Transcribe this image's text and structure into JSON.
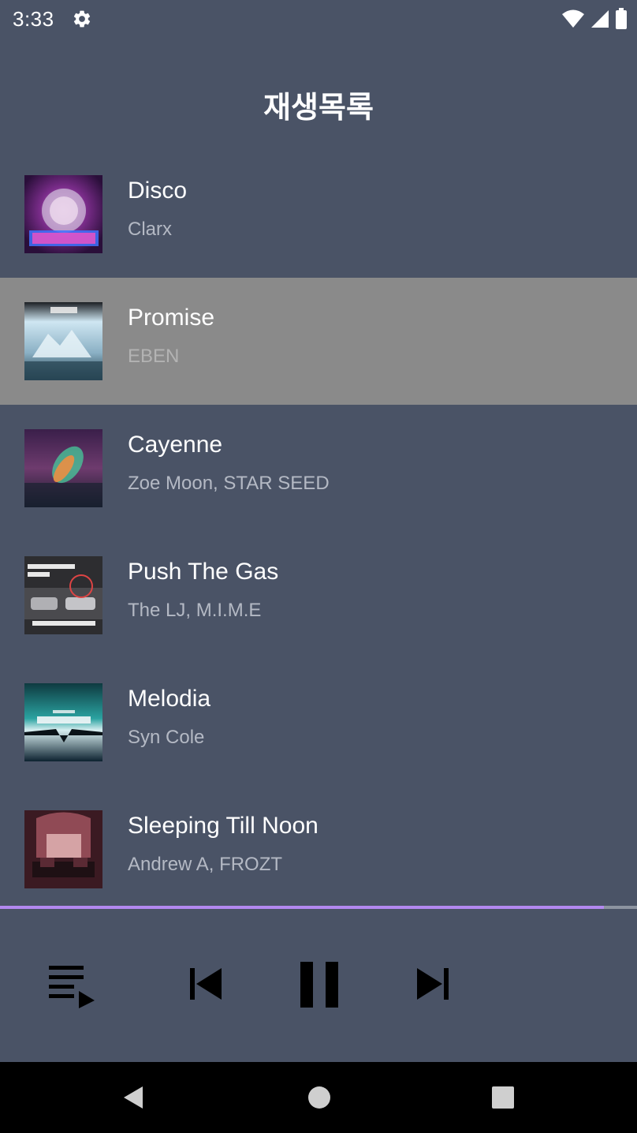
{
  "status_bar": {
    "time": "3:33",
    "icons": [
      "gear-icon",
      "wifi-icon",
      "signal-icon",
      "battery-icon"
    ]
  },
  "header": {
    "title": "재생목록"
  },
  "playlist": {
    "tracks": [
      {
        "title": "Disco",
        "artist": "Clarx",
        "selected": false
      },
      {
        "title": "Promise",
        "artist": "EBEN",
        "selected": true
      },
      {
        "title": "Cayenne",
        "artist": "Zoe Moon, STAR SEED",
        "selected": false
      },
      {
        "title": "Push The Gas",
        "artist": "The LJ, M.I.M.E",
        "selected": false
      },
      {
        "title": "Melodia",
        "artist": "Syn Cole",
        "selected": false
      },
      {
        "title": "Sleeping Till Noon",
        "artist": "Andrew A, FROZT",
        "selected": false
      }
    ]
  },
  "player": {
    "progress": 0.948,
    "controls": [
      "playlist-icon",
      "skip-previous-icon",
      "pause-icon",
      "skip-next-icon"
    ],
    "accent_color": "#b388f0"
  },
  "nav_bar": {
    "buttons": [
      "back-icon",
      "home-icon",
      "recents-icon"
    ]
  }
}
